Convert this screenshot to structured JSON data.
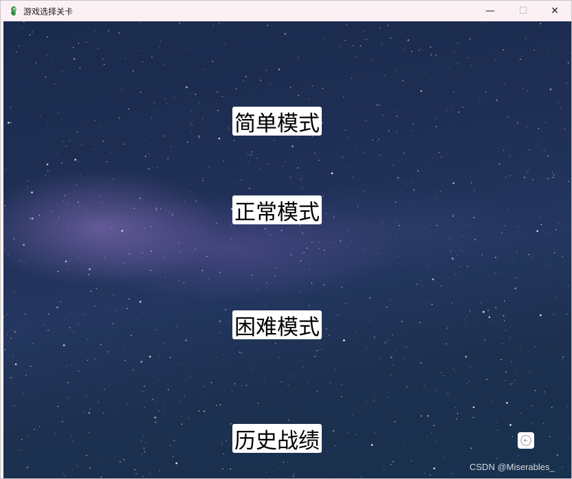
{
  "window": {
    "title": "游戏选择关卡",
    "controls": {
      "minimize": "—",
      "maximize": "☐",
      "close": "✕"
    }
  },
  "menu": {
    "easy": "简单模式",
    "normal": "正常模式",
    "hard": "困难模式",
    "history": "历史战绩"
  },
  "back_button": {
    "icon": "back-arrow-icon"
  },
  "watermark": "CSDN @Miserables_",
  "colors": {
    "titlebar": "#fbf1f4",
    "sky": "#1f2f55",
    "button": "#ffffff"
  }
}
